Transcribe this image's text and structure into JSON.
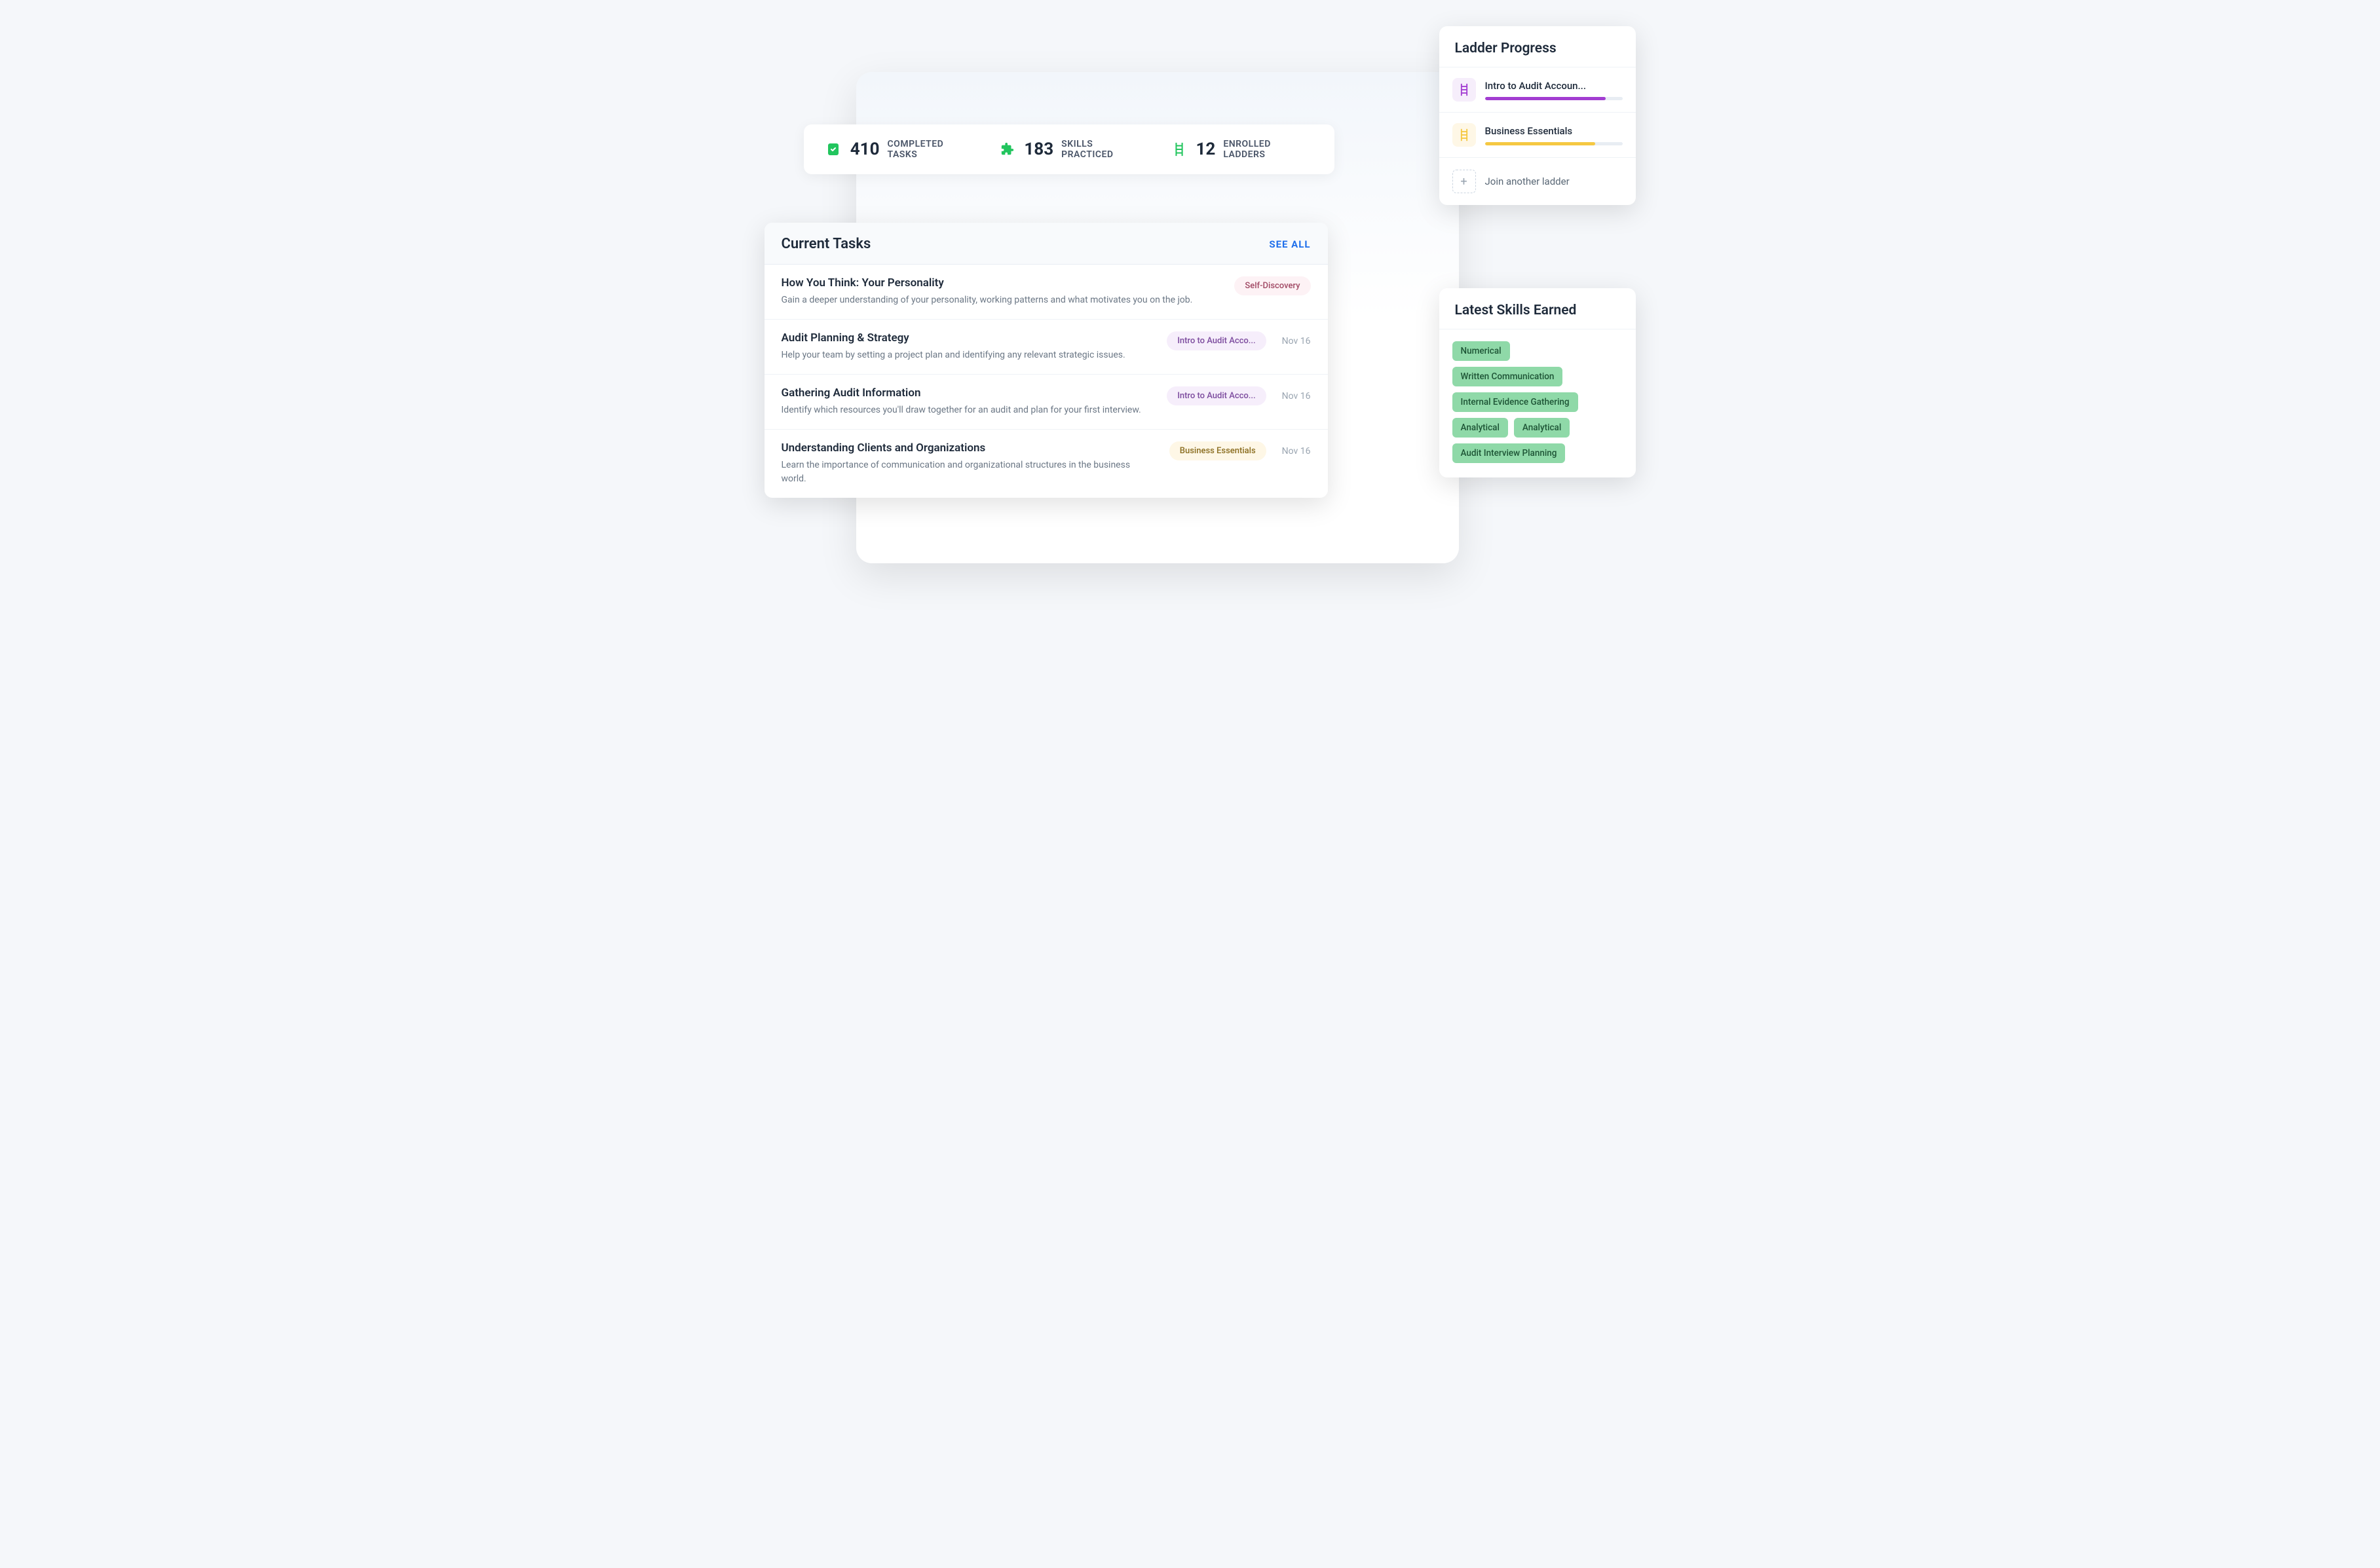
{
  "stats": {
    "completed": {
      "value": "410",
      "label": "COMPLETED TASKS"
    },
    "skills": {
      "value": "183",
      "label": "SKILLS PRACTICED"
    },
    "ladders": {
      "value": "12",
      "label": "ENROLLED LADDERS"
    }
  },
  "tasks": {
    "heading": "Current Tasks",
    "see_all": "SEE ALL",
    "items": [
      {
        "title": "How You Think: Your Personality",
        "desc": "Gain a deeper understanding of your personality, working patterns and what motivates you on the job.",
        "pill": "Self-Discovery",
        "pill_class": "pill-pink",
        "date": ""
      },
      {
        "title": "Audit Planning & Strategy",
        "desc": "Help your team by setting a project plan and identifying any relevant strategic issues.",
        "pill": "Intro to Audit Acco...",
        "pill_class": "pill-purple",
        "date": "Nov 16"
      },
      {
        "title": "Gathering Audit Information",
        "desc": "Identify which resources you'll draw together for an audit and plan for your first interview.",
        "pill": "Intro to Audit Acco...",
        "pill_class": "pill-purple",
        "date": "Nov 16"
      },
      {
        "title": "Understanding Clients and Organizations",
        "desc": "Learn the importance of communication and organizational structures in the business world.",
        "pill": "Business Essentials",
        "pill_class": "pill-yellow",
        "date": "Nov 16"
      }
    ]
  },
  "ladder_progress": {
    "heading": "Ladder Progress",
    "items": [
      {
        "name": "Intro to Audit Accoun...",
        "pct": 88,
        "color": "purple"
      },
      {
        "name": "Business Essentials",
        "pct": 80,
        "color": "yellow"
      }
    ],
    "join": "Join another ladder"
  },
  "skills_earned": {
    "heading": "Latest Skills Earned",
    "items": [
      "Numerical",
      "Written Communication",
      "Internal Evidence Gathering",
      "Analytical",
      "Analytical",
      "Audit Interview Planning"
    ]
  }
}
